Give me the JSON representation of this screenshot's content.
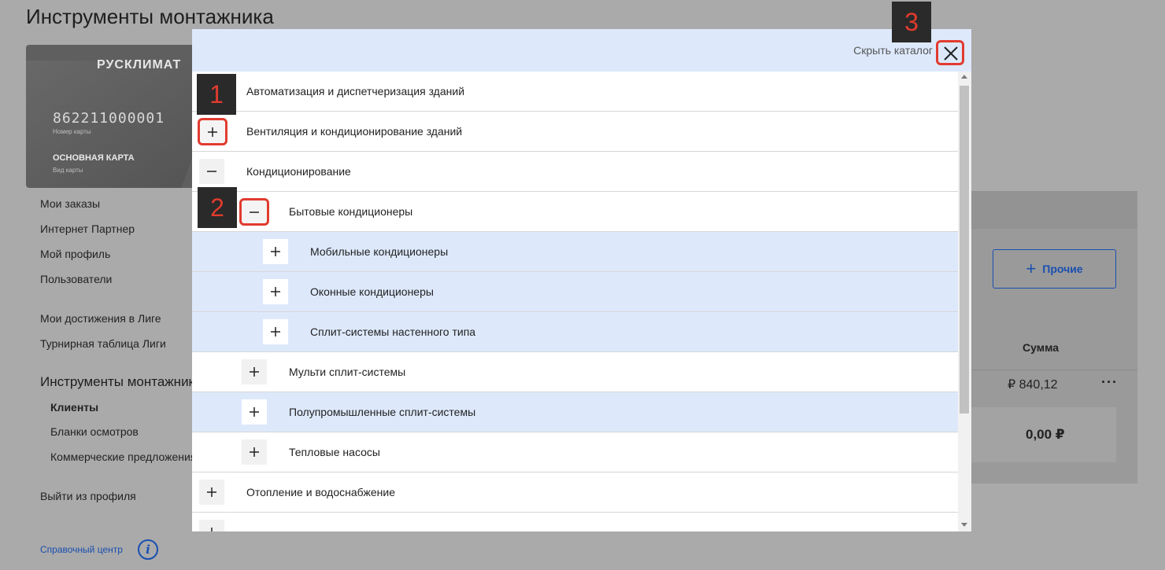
{
  "page": {
    "title": "Инструменты монтажника"
  },
  "card": {
    "brand": "РУСКЛИМАТ",
    "number": "862211000001",
    "number_label": "Номер карты",
    "type": "ОСНОВНАЯ КАРТА",
    "type_label": "Вид карты"
  },
  "sidebar": {
    "links": [
      "Мои заказы",
      "Интернет Партнер",
      "Мой профиль",
      "Пользователи",
      "Мои достижения в Лиге",
      "Турнирная таблица Лиги"
    ],
    "section": "Инструменты монтажника",
    "subs": [
      "Клиенты",
      "Бланки осмотров",
      "Коммерческие предложения"
    ],
    "logout": "Выйти из профиля",
    "help": "Справочный центр"
  },
  "right": {
    "other_button": "Прочие",
    "sum_header": "Сумма",
    "sum_value": "₽ 840,12",
    "more": "···",
    "total": "0,00 ₽"
  },
  "catalog": {
    "hide_label": "Скрыть каталог",
    "items": [
      {
        "label": "Автоматизация и диспетчеризация зданий",
        "level": 0,
        "state": "none"
      },
      {
        "label": "Вентиляция и кондиционирование зданий",
        "level": 0,
        "state": "collapsed"
      },
      {
        "label": "Кондиционирование",
        "level": 0,
        "state": "expanded"
      },
      {
        "label": "Бытовые кондиционеры",
        "level": 1,
        "state": "expanded"
      },
      {
        "label": "Мобильные кондиционеры",
        "level": 2,
        "state": "collapsed"
      },
      {
        "label": "Оконные кондиционеры",
        "level": 2,
        "state": "collapsed"
      },
      {
        "label": "Сплит-системы настенного типа",
        "level": 2,
        "state": "collapsed"
      },
      {
        "label": "Мульти сплит-системы",
        "level": 1,
        "state": "collapsed"
      },
      {
        "label": "Полупромышленные сплит-системы",
        "level": 1,
        "state": "collapsed"
      },
      {
        "label": "Тепловые насосы",
        "level": 1,
        "state": "collapsed"
      },
      {
        "label": "Отопление и водоснабжение",
        "level": 0,
        "state": "collapsed"
      }
    ]
  },
  "annotations": [
    "1",
    "2",
    "3"
  ],
  "colors": {
    "highlight": "#e13b2f",
    "accent": "#1a4fb0",
    "row_blue": "#dde9fb"
  }
}
